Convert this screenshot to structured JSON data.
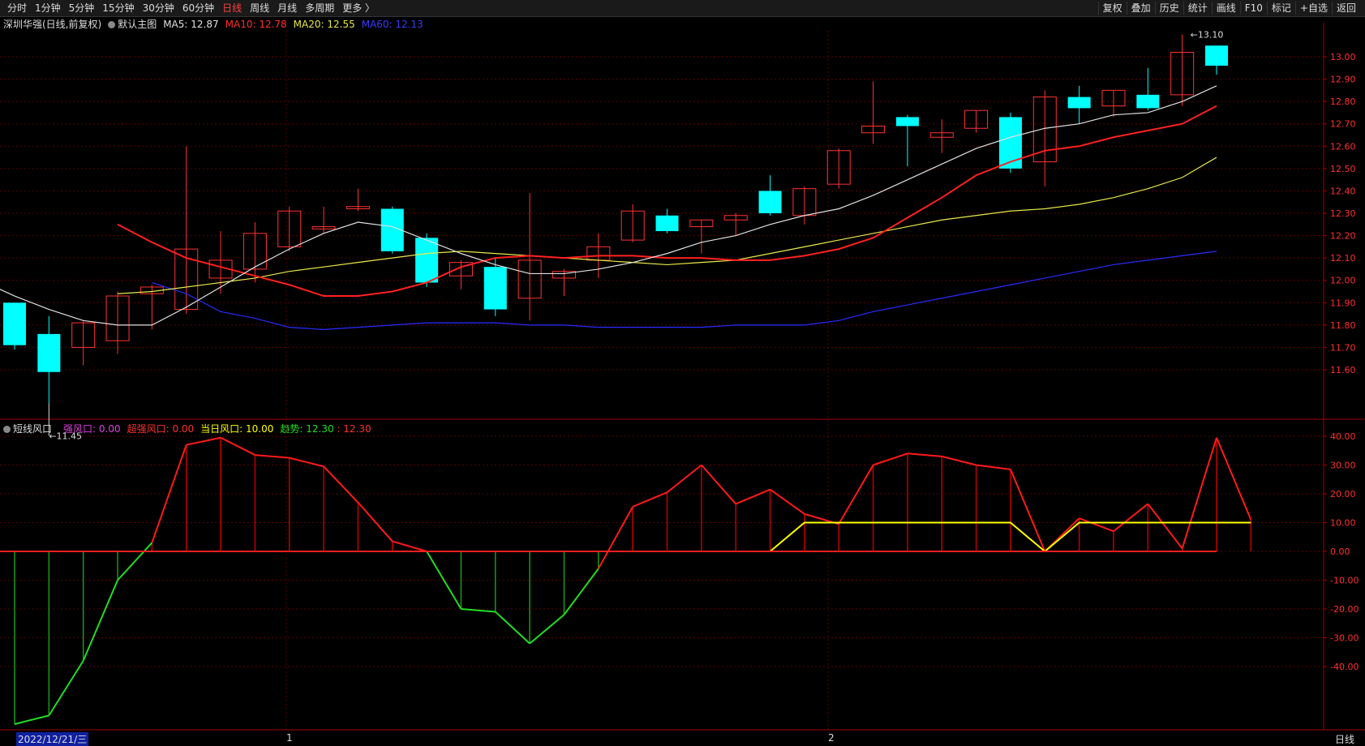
{
  "toolbar": {
    "timeframes": [
      "分时",
      "1分钟",
      "5分钟",
      "15分钟",
      "30分钟",
      "60分钟",
      "日线",
      "周线",
      "月线",
      "多周期",
      "更多 〉"
    ],
    "active_timeframe": "日线",
    "tools": [
      "复权",
      "叠加",
      "历史",
      "统计",
      "画线",
      "F10",
      "标记",
      "+自选",
      "返回"
    ]
  },
  "main_legend": {
    "stock": "深圳华强(日线,前复权)",
    "indicator": "默认主图",
    "ma5": "MA5: 12.87",
    "ma10": "MA10: 12.78",
    "ma20": "MA20: 12.55",
    "ma60": "MA60: 12.13"
  },
  "sub_legend": {
    "name": "短线风口",
    "strong": "强风口: 0.00",
    "super": "超强风口: 0.00",
    "today": "当日风口: 10.00",
    "trend1": "趋势: 12.30",
    "trend2": ": 12.30"
  },
  "colors": {
    "up": "#ff3232",
    "down": "#00ffff",
    "ma5": "#e0e0e0",
    "ma10": "#ff2020",
    "ma20": "#e8e84a",
    "ma60": "#2a2aff",
    "osc_up": "#ff1a1a",
    "osc_down": "#22dd22",
    "trend": "#ffff00"
  },
  "chart_data": [
    {
      "type": "candlestick",
      "ylim": [
        11.45,
        13.15
      ],
      "y_ticks": [
        11.6,
        11.7,
        11.8,
        11.9,
        12.0,
        12.1,
        12.2,
        12.3,
        12.4,
        12.5,
        12.6,
        12.7,
        12.8,
        12.9,
        13.0
      ],
      "y_tick_labels": [
        "11.60",
        "11.70",
        "11.80",
        "11.90",
        "12.00",
        "12.10",
        "12.20",
        "12.30",
        "12.40",
        "12.50",
        "12.60",
        "12.70",
        "12.80",
        "12.90",
        "13.00"
      ],
      "candles": [
        {
          "o": 11.9,
          "h": 11.9,
          "l": 11.69,
          "c": 11.71
        },
        {
          "o": 11.76,
          "h": 11.84,
          "l": 11.45,
          "c": 11.59
        },
        {
          "o": 11.7,
          "h": 11.82,
          "l": 11.62,
          "c": 11.81
        },
        {
          "o": 11.73,
          "h": 11.95,
          "l": 11.67,
          "c": 11.93
        },
        {
          "o": 11.94,
          "h": 11.98,
          "l": 11.78,
          "c": 11.97
        },
        {
          "o": 11.87,
          "h": 12.6,
          "l": 11.85,
          "c": 12.14
        },
        {
          "o": 12.01,
          "h": 12.22,
          "l": 11.94,
          "c": 12.09
        },
        {
          "o": 12.05,
          "h": 12.26,
          "l": 11.99,
          "c": 12.21
        },
        {
          "o": 12.15,
          "h": 12.33,
          "l": 12.13,
          "c": 12.31
        },
        {
          "o": 12.23,
          "h": 12.33,
          "l": 12.21,
          "c": 12.24
        },
        {
          "o": 12.32,
          "h": 12.41,
          "l": 12.31,
          "c": 12.33
        },
        {
          "o": 12.32,
          "h": 12.33,
          "l": 12.12,
          "c": 12.13
        },
        {
          "o": 12.19,
          "h": 12.21,
          "l": 11.97,
          "c": 11.99
        },
        {
          "o": 12.02,
          "h": 12.09,
          "l": 11.96,
          "c": 12.08
        },
        {
          "o": 12.06,
          "h": 12.1,
          "l": 11.84,
          "c": 11.87
        },
        {
          "o": 11.92,
          "h": 12.39,
          "l": 11.82,
          "c": 12.09
        },
        {
          "o": 12.01,
          "h": 12.05,
          "l": 11.93,
          "c": 12.04
        },
        {
          "o": 12.09,
          "h": 12.21,
          "l": 12.01,
          "c": 12.15
        },
        {
          "o": 12.18,
          "h": 12.34,
          "l": 12.17,
          "c": 12.31
        },
        {
          "o": 12.29,
          "h": 12.32,
          "l": 12.21,
          "c": 12.22
        },
        {
          "o": 12.24,
          "h": 12.27,
          "l": 12.12,
          "c": 12.27
        },
        {
          "o": 12.27,
          "h": 12.3,
          "l": 12.2,
          "c": 12.29
        },
        {
          "o": 12.4,
          "h": 12.47,
          "l": 12.29,
          "c": 12.3
        },
        {
          "o": 12.29,
          "h": 12.42,
          "l": 12.25,
          "c": 12.41
        },
        {
          "o": 12.43,
          "h": 12.59,
          "l": 12.41,
          "c": 12.58
        },
        {
          "o": 12.66,
          "h": 12.89,
          "l": 12.61,
          "c": 12.69
        },
        {
          "o": 12.73,
          "h": 12.74,
          "l": 12.51,
          "c": 12.69
        },
        {
          "o": 12.64,
          "h": 12.72,
          "l": 12.57,
          "c": 12.66
        },
        {
          "o": 12.68,
          "h": 12.76,
          "l": 12.66,
          "c": 12.76
        },
        {
          "o": 12.73,
          "h": 12.75,
          "l": 12.48,
          "c": 12.5
        },
        {
          "o": 12.53,
          "h": 12.85,
          "l": 12.42,
          "c": 12.82
        },
        {
          "o": 12.82,
          "h": 12.87,
          "l": 12.7,
          "c": 12.77
        },
        {
          "o": 12.78,
          "h": 12.85,
          "l": 12.73,
          "c": 12.85
        },
        {
          "o": 12.83,
          "h": 12.95,
          "l": 12.76,
          "c": 12.77
        },
        {
          "o": 12.83,
          "h": 13.1,
          "l": 12.78,
          "c": 13.02
        },
        {
          "o": 13.05,
          "h": 13.05,
          "l": 12.92,
          "c": 12.96
        }
      ],
      "ma5": [
        12.0,
        11.93,
        11.87,
        11.82,
        11.8,
        11.8,
        11.88,
        11.97,
        12.06,
        12.14,
        12.21,
        12.26,
        12.24,
        12.18,
        12.12,
        12.07,
        12.03,
        12.03,
        12.05,
        12.08,
        12.12,
        12.17,
        12.2,
        12.25,
        12.29,
        12.32,
        12.38,
        12.45,
        12.52,
        12.59,
        12.64,
        12.68,
        12.7,
        12.74,
        12.75,
        12.8,
        12.87
      ],
      "ma10": [
        12.25,
        12.17,
        12.1,
        12.06,
        12.02,
        11.98,
        11.93,
        11.93,
        11.95,
        11.99,
        12.06,
        12.1,
        12.11,
        12.1,
        12.11,
        12.11,
        12.1,
        12.1,
        12.09,
        12.09,
        12.11,
        12.14,
        12.19,
        12.28,
        12.37,
        12.47,
        12.53,
        12.58,
        12.6,
        12.64,
        12.67,
        12.7,
        12.78
      ],
      "ma20": [
        11.94,
        11.95,
        11.97,
        11.99,
        12.01,
        12.04,
        12.06,
        12.08,
        12.1,
        12.12,
        12.13,
        12.12,
        12.11,
        12.1,
        12.09,
        12.08,
        12.07,
        12.08,
        12.09,
        12.12,
        12.15,
        12.18,
        12.21,
        12.24,
        12.27,
        12.29,
        12.31,
        12.32,
        12.34,
        12.37,
        12.41,
        12.46,
        12.55
      ],
      "ma60": [
        11.99,
        11.94,
        11.86,
        11.83,
        11.79,
        11.78,
        11.79,
        11.8,
        11.81,
        11.81,
        11.81,
        11.8,
        11.8,
        11.79,
        11.79,
        11.79,
        11.79,
        11.8,
        11.8,
        11.8,
        11.82,
        11.86,
        11.89,
        11.92,
        11.95,
        11.98,
        12.01,
        12.04,
        12.07,
        12.09,
        12.11,
        12.13
      ],
      "annotations": [
        "13.10",
        "11.45"
      ]
    },
    {
      "type": "line",
      "name": "短线风口",
      "ylim": [
        -45,
        45
      ],
      "y_ticks": [
        40,
        30,
        20,
        10,
        0,
        -10,
        -20,
        -30,
        -40
      ],
      "y_tick_labels": [
        "40.00",
        "30.00",
        "20.00",
        "10.00",
        "0.00",
        "-10.00",
        "-20.00",
        "-30.00",
        "-40.00"
      ],
      "oscillator": [
        -60,
        -57,
        -38,
        -10,
        3,
        37,
        39.5,
        33.5,
        32.5,
        29.5,
        17,
        3.5,
        0,
        -20,
        -21,
        -32,
        -22,
        -6,
        15.5,
        20.5,
        30,
        16.5,
        21.5,
        13,
        9.5,
        30,
        34,
        33,
        30,
        28.5,
        0,
        11.5,
        7,
        16.5,
        1,
        39.5,
        11
      ],
      "trend": [
        0,
        0,
        0,
        0,
        0,
        0,
        0,
        0,
        0,
        0,
        0,
        0,
        0,
        0,
        0,
        0,
        0,
        0,
        0,
        0,
        0,
        0,
        0,
        10,
        10,
        10,
        10,
        10,
        10,
        10,
        0,
        10,
        10,
        10,
        10,
        10,
        10
      ]
    }
  ],
  "xaxis": {
    "start_date": "2022/12/21/三",
    "month1": "1",
    "month2": "2"
  },
  "status": {
    "period": "日线"
  }
}
